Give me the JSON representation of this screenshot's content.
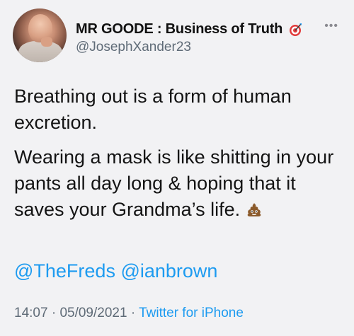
{
  "user": {
    "display_name": "MR GOODE : Business of Truth",
    "handle": "@JosephXander23",
    "badge_icon": "target-dart-icon"
  },
  "more_icon": "more-dots-icon",
  "more_glyph": "•••",
  "tweet": {
    "paragraph_1": "Breathing out is a form of human excretion.",
    "paragraph_2": "Wearing a mask is like shitting in your pants all day long & hoping that it saves your Grandma’s life.",
    "trailing_emoji_icon": "poop-emoji-icon",
    "mentions": [
      "@TheFreds",
      "@ianbrown"
    ]
  },
  "meta": {
    "time": "14:07",
    "separator": "·",
    "date": "05/09/2021",
    "source": "Twitter for iPhone"
  },
  "colors": {
    "link": "#1d9bf0",
    "muted": "#5f6b77",
    "background": "#f2f2f4"
  }
}
